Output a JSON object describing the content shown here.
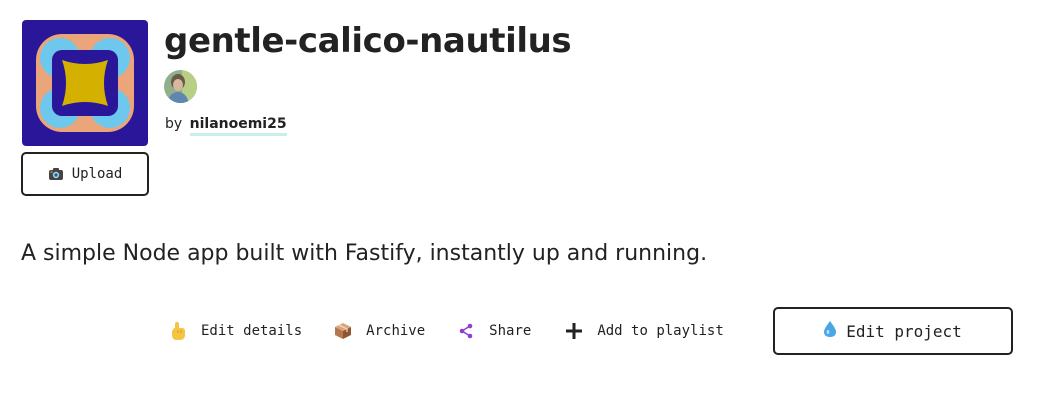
{
  "project": {
    "name": "gentle-calico-nautilus",
    "description": "A simple Node app built with Fastify, instantly up and running.",
    "avatar_colors": {
      "background": "#2a1699",
      "ring": "#eaa57a",
      "bubbles": "#6ec8ee",
      "center": "#d4b000"
    }
  },
  "owner": {
    "by_label": "by",
    "username": "nilanoemi25"
  },
  "upload": {
    "label": "Upload",
    "icon": "camera-icon"
  },
  "actions": [
    {
      "label": "Edit details",
      "icon": "pointing-hand-icon"
    },
    {
      "label": "Archive",
      "icon": "package-box-icon"
    },
    {
      "label": "Share",
      "icon": "share-icon"
    },
    {
      "label": "Add to playlist",
      "icon": "plus-icon"
    }
  ],
  "edit_project": {
    "label": "Edit project",
    "icon": "droplet-icon",
    "icon_color": "#4aa6e8"
  }
}
